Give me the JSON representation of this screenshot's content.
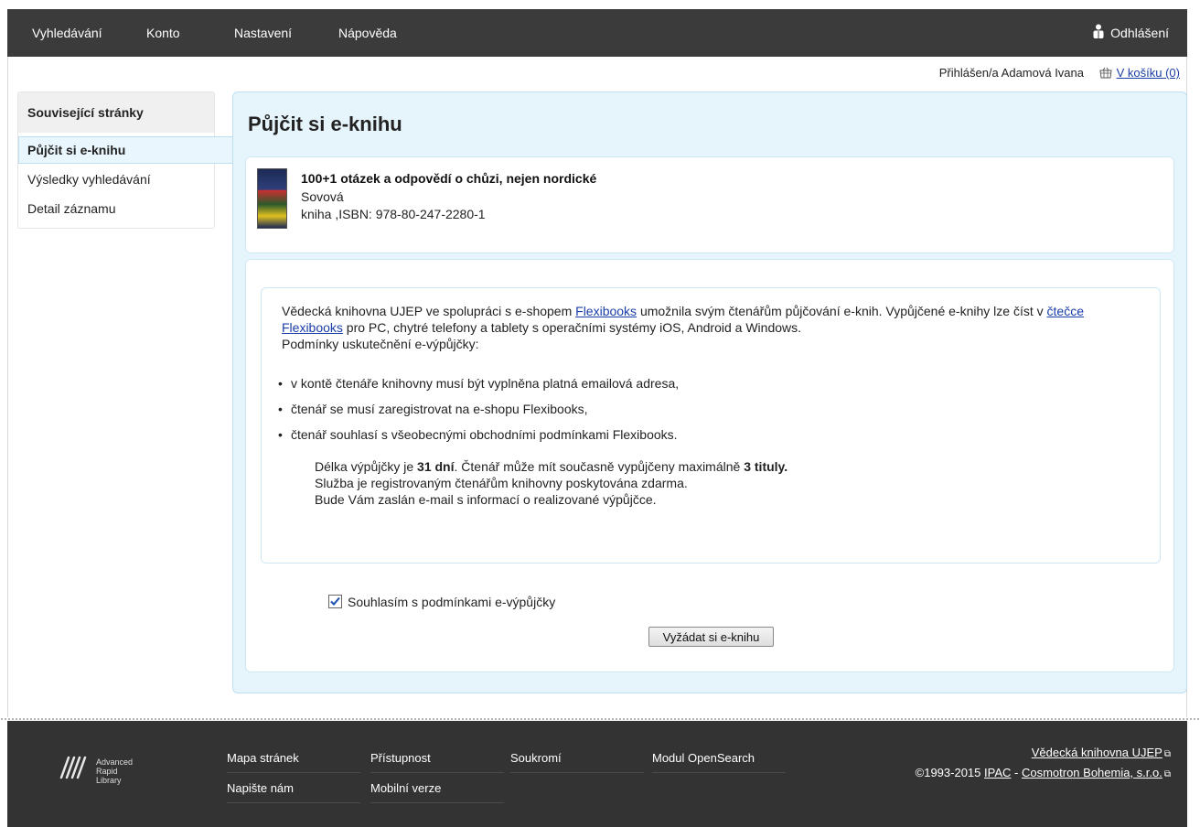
{
  "topnav": {
    "items": [
      "Vyhledávání",
      "Konto",
      "Nastavení",
      "Nápověda"
    ],
    "logout": "Odhlášení"
  },
  "userline": {
    "logged_in": "Přihlášen/a Adamová Ivana",
    "cart": "V košíku (0)"
  },
  "sidebar": {
    "title": "Související stránky",
    "items": [
      "Půjčit si e-knihu",
      "Výsledky vyhledávání",
      "Detail záznamu"
    ]
  },
  "main": {
    "title": "Půjčit si e-knihu",
    "book": {
      "title": "100+1 otázek a odpovědí o chůzi, nejen nordické",
      "author": "Sovová",
      "type_isbn": "kniha ,ISBN: 978-80-247-2280-1"
    },
    "terms": {
      "intro_before": "Vědecká knihovna UJEP ve spolupráci s e-shopem ",
      "link1": "Flexibooks",
      "intro_middle": " umožnila svým čtenářům půjčování e-knih. Vypůjčené e-knihy lze číst v ",
      "link2a": "čtečce",
      "link2b": "Flexibooks",
      "intro_after": " pro PC, chytré telefony a tablety s operačními systémy iOS, Android a Windows.",
      "conditions_heading": "Podmínky uskutečnění e-výpůjčky:",
      "bullets": [
        "v kontě čtenáře knihovny musí být vyplněna platná emailová adresa,",
        "čtenář se musí zaregistrovat na e-shopu Flexibooks,",
        "čtenář souhlasí s všeobecnými obchodními podmínkami Flexibooks."
      ],
      "loan_a": "Délka výpůjčky je ",
      "loan_days": "31 dní",
      "loan_b": ". Čtenář může mít současně vypůjčeny maximálně ",
      "loan_titles": "3 tituly.",
      "free": "Služba je registrovaným čtenářům knihovny poskytována zdarma.",
      "email": "Bude Vám zaslán e-mail s informací o realizované výpůjčce."
    },
    "agree_label": "Souhlasím s podmínkami e-výpůjčky",
    "agree_checked": true,
    "request_button": "Vyžádat si e-knihu"
  },
  "footer": {
    "logo_text": [
      "Advanced",
      "Rapid",
      "Library"
    ],
    "links": [
      "Mapa stránek",
      "Přístupnost",
      "Soukromí",
      "Modul OpenSearch",
      "Napište nám",
      "Mobilní verze"
    ],
    "library": "Vědecká knihovna UJEP",
    "copyright": "©1993-2015 ",
    "ipac": "IPAC",
    "dash": " - ",
    "cosmotron": "Cosmotron Bohemia, s.r.o."
  }
}
